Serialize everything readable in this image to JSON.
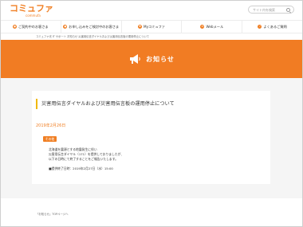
{
  "header": {
    "logo_text": "コミュファ",
    "logo_sub": "commufa",
    "search_placeholder": "サイト内を検索"
  },
  "gnav": {
    "items": [
      {
        "label": "ご契約中のお客さま",
        "icon": "person-icon"
      },
      {
        "label": "お申し込みをご検討中のお客さま",
        "icon": "document-icon"
      },
      {
        "label": "Myコミュファ",
        "icon": "heart-icon"
      },
      {
        "label": "Webメール",
        "icon": "mail-icon"
      },
      {
        "label": "よくあるご質問",
        "icon": "question-icon"
      }
    ]
  },
  "breadcrumb": "コミュファ光 IT  サポート  お知らせ  災害用伝言ダイヤルおよび災害用伝言板の運用停止について",
  "hero": {
    "title": "お知らせ"
  },
  "article": {
    "title": "災害用伝言ダイヤルおよび災害用伝言板の運用停止について",
    "date": "2019年2月26日",
    "category": "その他",
    "body_lines": [
      "北海道を震源とする地震発生に伴い",
      "災害用伝言ダイヤル（171）を提供しておりましたが、",
      "以下の日時にて終了することをご報告いたします。"
    ],
    "deadline": "■提供終了日時：2019年2月27日（水）15:00"
  },
  "footer": {
    "links": [
      "「お知らせ」TOPページへ"
    ]
  },
  "colors": {
    "accent": "#f17c23",
    "title_bar": "#f0b800",
    "background": "#f5f5f5"
  }
}
